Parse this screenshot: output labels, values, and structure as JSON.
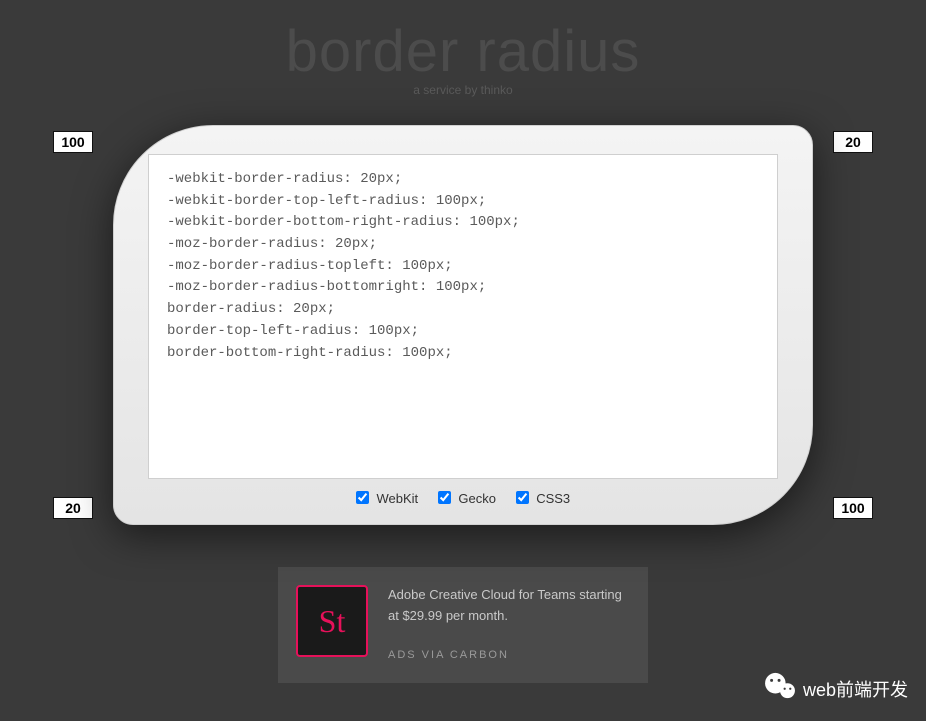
{
  "header": {
    "title": "border radius",
    "subtitle": "a service by thinko"
  },
  "radii": {
    "tl": "100",
    "tr": "20",
    "bl": "20",
    "br": "100"
  },
  "code": "-webkit-border-radius: 20px;\n-webkit-border-top-left-radius: 100px;\n-webkit-border-bottom-right-radius: 100px;\n-moz-border-radius: 20px;\n-moz-border-radius-topleft: 100px;\n-moz-border-radius-bottomright: 100px;\nborder-radius: 20px;\nborder-top-left-radius: 100px;\nborder-bottom-right-radius: 100px;",
  "options": {
    "webkit": {
      "label": "WebKit",
      "checked": true
    },
    "gecko": {
      "label": "Gecko",
      "checked": true
    },
    "css3": {
      "label": "CSS3",
      "checked": true
    }
  },
  "ad": {
    "icon_text": "St",
    "text": "Adobe Creative Cloud for Teams starting at $29.99 per month.",
    "via": "ADS VIA CARBON"
  },
  "wechat": {
    "label": "web前端开发"
  }
}
